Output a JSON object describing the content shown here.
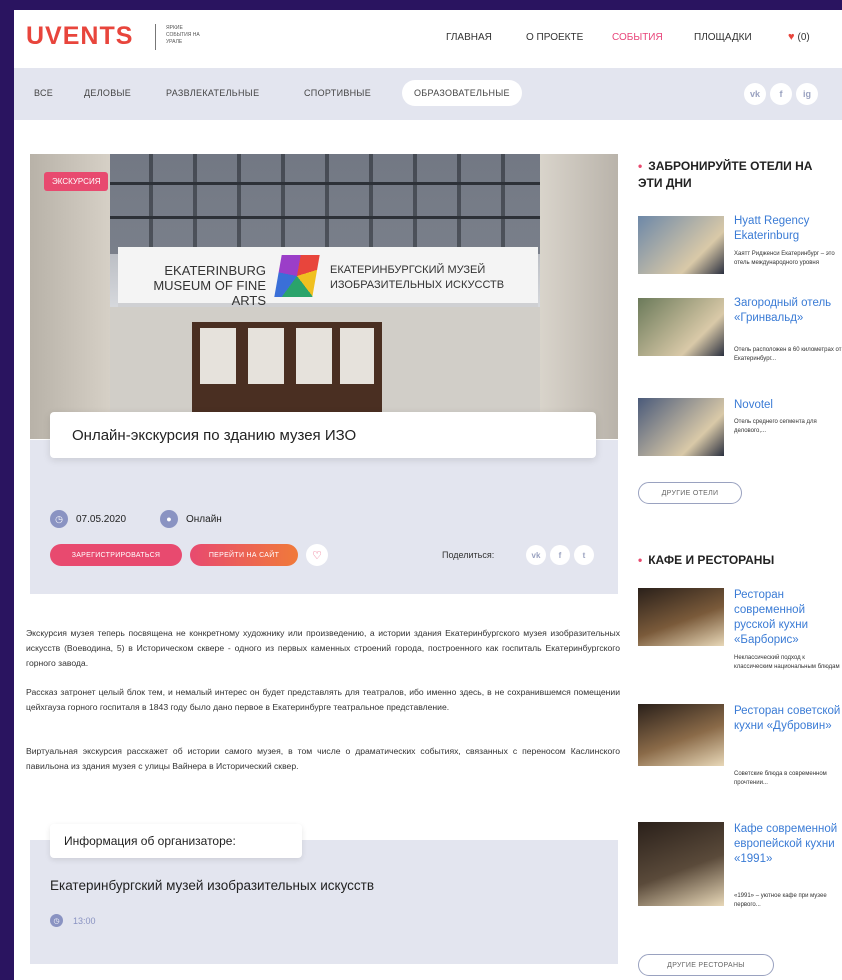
{
  "header": {
    "logo": "UVENTS",
    "tagline": "ЯРКИЕ СОБЫТИЯ НА УРАЛЕ",
    "nav": [
      {
        "label": "ГЛАВНАЯ",
        "active": false
      },
      {
        "label": "О ПРОЕКТЕ",
        "active": false
      },
      {
        "label": "СОБЫТИЯ",
        "active": true
      },
      {
        "label": "ПЛОЩАДКИ",
        "active": false
      }
    ],
    "favorites_label": "(0)"
  },
  "categories": {
    "items": [
      "ВСЕ",
      "ДЕЛОВЫЕ",
      "РАЗВЛЕКАТЕЛЬНЫЕ",
      "СПОРТИВНЫЕ",
      "ОБРАЗОВАТЕЛЬНЫЕ"
    ],
    "selected": "ОБРАЗОВАТЕЛЬНЫЕ",
    "social": [
      "vk",
      "f",
      "ig"
    ]
  },
  "event": {
    "badge": "ЭКСКУРСИЯ",
    "sign_en": "EKATERINBURG MUSEUM OF FINE ARTS",
    "sign_ru": "ЕКАТЕРИНБУРГСКИЙ МУЗЕЙ ИЗОБРАЗИТЕЛЬНЫХ ИСКУССТВ",
    "title": "Онлайн-экскурсия по зданию музея ИЗО",
    "date": "07.05.2020",
    "location": "Онлайн",
    "register_label": "ЗАРЕГИСТРИРОВАТЬСЯ",
    "site_label": "ПЕРЕЙТИ НА САЙТ",
    "share_label": "Поделиться:",
    "description": [
      "Экскурсия музея теперь посвящена не конкретному художнику или произведению, а истории здания Екатеринбургского музея изобразительных искусств (Воеводина, 5) в Историческом сквере - одного из первых каменных строений города, построенного как госпиталь Екатеринбургского горного завода.",
      "Рассказ затронет целый блок тем, и немалый интерес он будет представлять для театралов, ибо именно здесь, в не сохранившемся помещении цейхгауза горного госпиталя в 1843 году было дано первое в Екатеринбурге театральное представление.",
      "Виртуальная экскурсия расскажет об истории самого музея, в том числе о драматических событиях, связанных с переносом Каслинского павильона из здания музея с улицы Вайнера в Исторический сквер."
    ]
  },
  "organizer": {
    "tab_label": "Информация об организаторе:",
    "name": "Екатеринбургский музей изобразительных искусств",
    "time": "13:00"
  },
  "sidebar": {
    "hotels_heading": "ЗАБРОНИРУЙТЕ ОТЕЛИ НА ЭТИ ДНИ",
    "hotels": [
      {
        "title": "Hyatt Regency Ekaterinburg",
        "desc": "Хаятт Ридженси Екатеринбург – это отель международного уровня",
        "color": "#6d88a8"
      },
      {
        "title": "Загородный отель «Гринвальд»",
        "desc": "Отель расположен в 60 километрах от Екатеринбург...",
        "color": "#6b7a5a"
      },
      {
        "title": "Novotel",
        "desc": "Отель среднего сегмента для делового,...",
        "color": "#4a5a7a"
      }
    ],
    "hotels_more": "ДРУГИЕ ОТЕЛИ",
    "cafes_heading": "КАФЕ И РЕСТОРАНЫ",
    "cafes": [
      {
        "title": "Ресторан современной русской кухни «Барборис»",
        "desc": "Неклассический подход к классическим национальным блюдам",
        "color": "#7a5a3a"
      },
      {
        "title": "Ресторан советской кухни «Дубровин»",
        "desc": "Советские блюда в современном прочтении...",
        "color": "#8a6a48"
      },
      {
        "title": "Кафе современной европейской кухни «1991»",
        "desc": "«1991» – уютное кафе при музее первого...",
        "color": "#5a4a3a"
      }
    ],
    "cafes_more": "ДРУГИЕ РЕСТОРАНЫ"
  }
}
